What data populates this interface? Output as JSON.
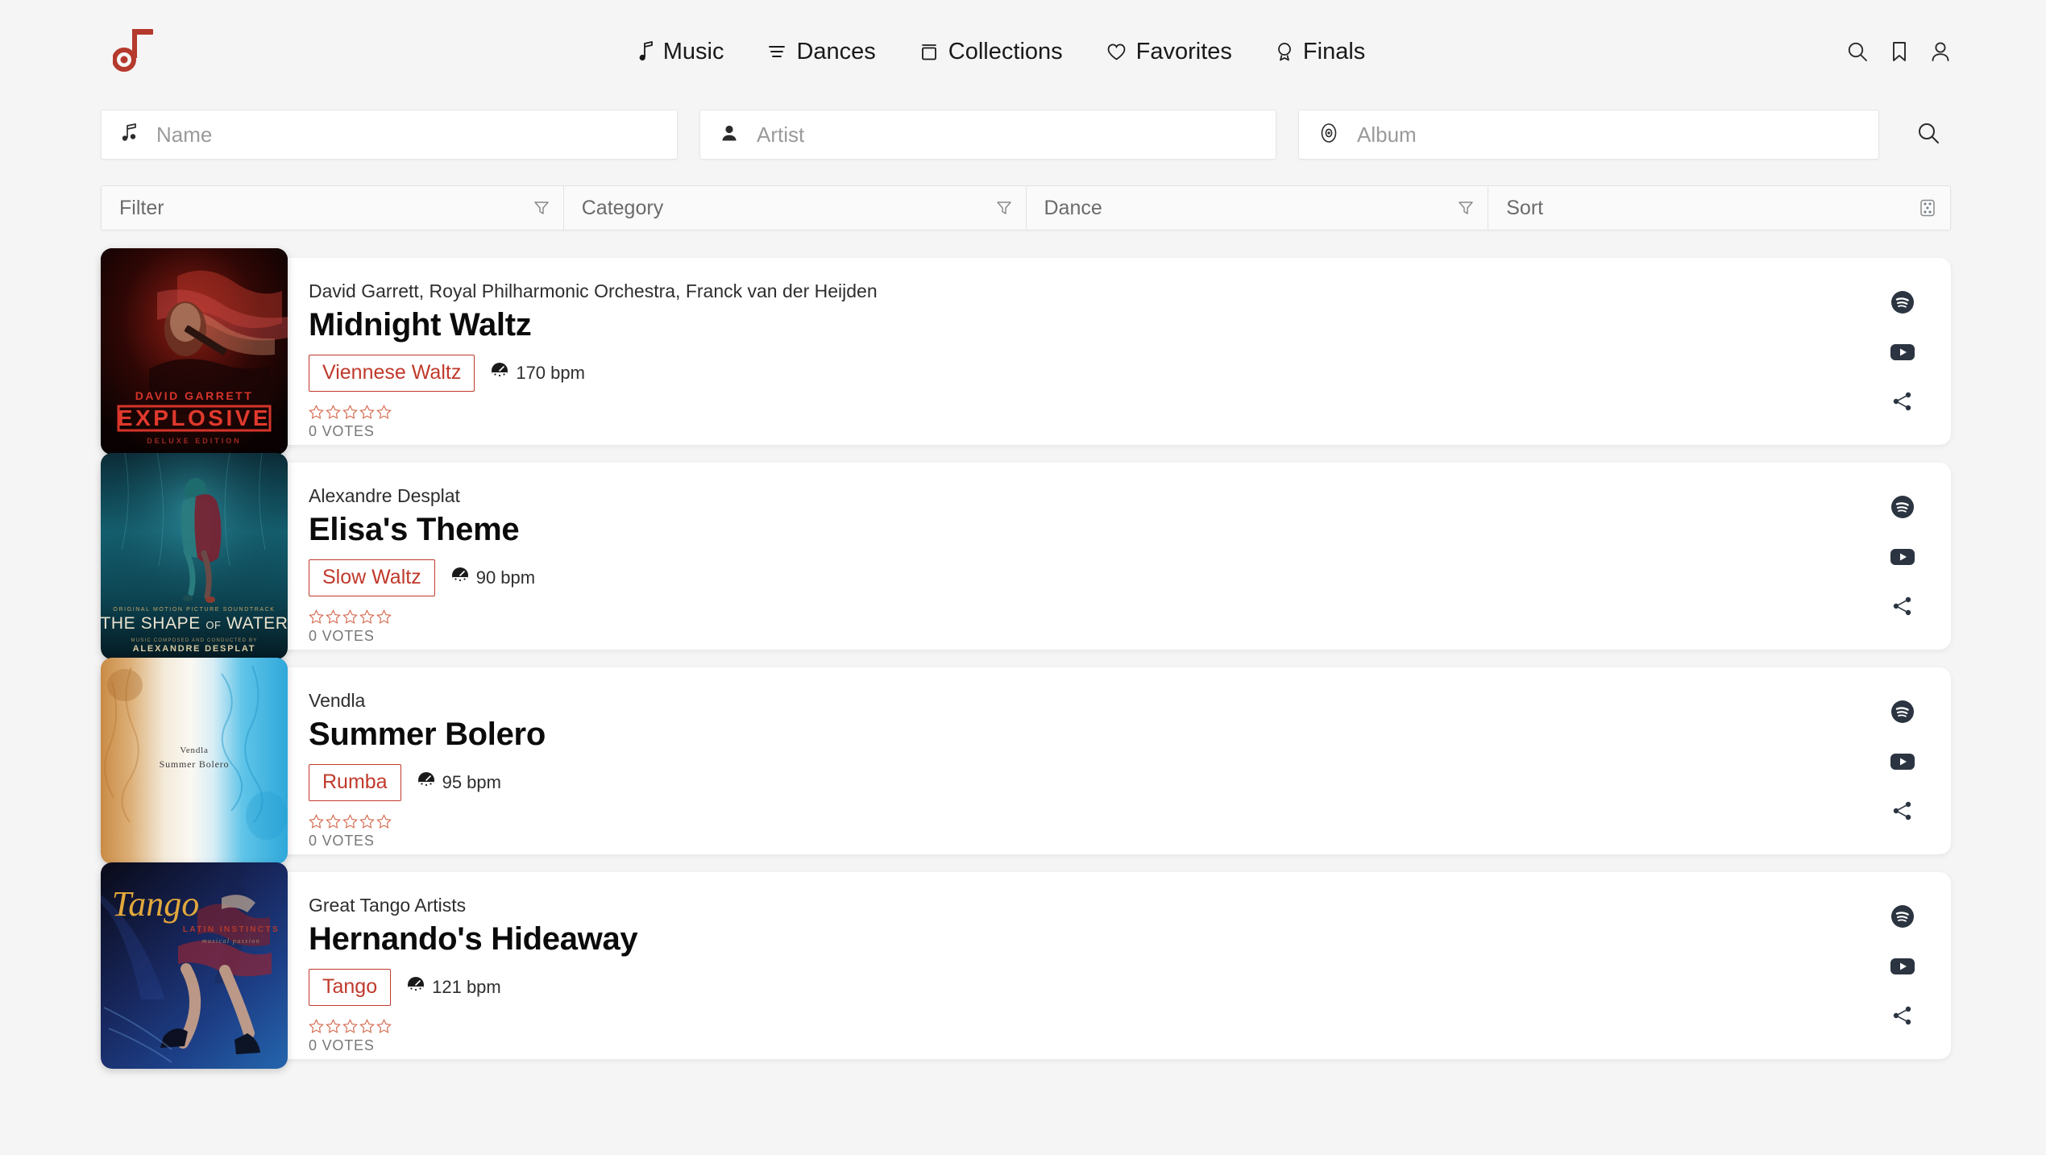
{
  "brand": {
    "logo_icon": "music-note-logo",
    "accent": "#c0392b"
  },
  "nav": {
    "items": [
      {
        "label": "Music",
        "icon": "music-note-icon"
      },
      {
        "label": "Dances",
        "icon": "list-lines-icon"
      },
      {
        "label": "Collections",
        "icon": "box-icon"
      },
      {
        "label": "Favorites",
        "icon": "heart-icon"
      },
      {
        "label": "Finals",
        "icon": "trophy-icon"
      }
    ]
  },
  "header_actions": [
    {
      "name": "search-icon"
    },
    {
      "name": "bookmark-icon"
    },
    {
      "name": "user-icon"
    }
  ],
  "search": {
    "name": {
      "placeholder": "Name",
      "value": "",
      "icon": "music-note-icon"
    },
    "artist": {
      "placeholder": "Artist",
      "value": "",
      "icon": "person-icon"
    },
    "album": {
      "placeholder": "Album",
      "value": "",
      "icon": "disc-icon"
    },
    "submit_icon": "search-icon"
  },
  "filters": [
    {
      "label": "Filter",
      "icon": "funnel-icon"
    },
    {
      "label": "Category",
      "icon": "funnel-icon"
    },
    {
      "label": "Dance",
      "icon": "funnel-icon"
    },
    {
      "label": "Sort",
      "icon": "dice-icon"
    }
  ],
  "songs": [
    {
      "artist": "David Garrett, Royal Philharmonic Orchestra, Franck van der Heijden",
      "title": "Midnight Waltz",
      "dance": "Viennese Waltz",
      "bpm": "170 bpm",
      "rating": 0,
      "votes": "0 VOTES",
      "album_art": {
        "style": "explosive",
        "line1": "DAVID GARRETT",
        "line2": "EXPLOSIVE",
        "line3": "DELUXE EDITION"
      }
    },
    {
      "artist": "Alexandre Desplat",
      "title": "Elisa's Theme",
      "dance": "Slow Waltz",
      "bpm": "90 bpm",
      "rating": 0,
      "votes": "0 VOTES",
      "album_art": {
        "style": "water",
        "line1": "ORIGINAL MOTION PICTURE SOUNDTRACK",
        "line2": "THE SHAPE OF WATER",
        "line3": "ALEXANDRE DESPLAT"
      }
    },
    {
      "artist": "Vendla",
      "title": "Summer Bolero",
      "dance": "Rumba",
      "bpm": "95 bpm",
      "rating": 0,
      "votes": "0 VOTES",
      "album_art": {
        "style": "bolero",
        "line1": "Vendla",
        "line2": "Summer Bolero",
        "line3": ""
      }
    },
    {
      "artist": "Great Tango Artists",
      "title": "Hernando's Hideaway",
      "dance": "Tango",
      "bpm": "121 bpm",
      "rating": 0,
      "votes": "0 VOTES",
      "album_art": {
        "style": "tango",
        "line1": "Tango",
        "line2": "LATIN INSTINCTS",
        "line3": "musical passion"
      }
    }
  ],
  "card_actions": [
    {
      "name": "spotify-icon"
    },
    {
      "name": "youtube-icon"
    },
    {
      "name": "share-icon"
    }
  ]
}
